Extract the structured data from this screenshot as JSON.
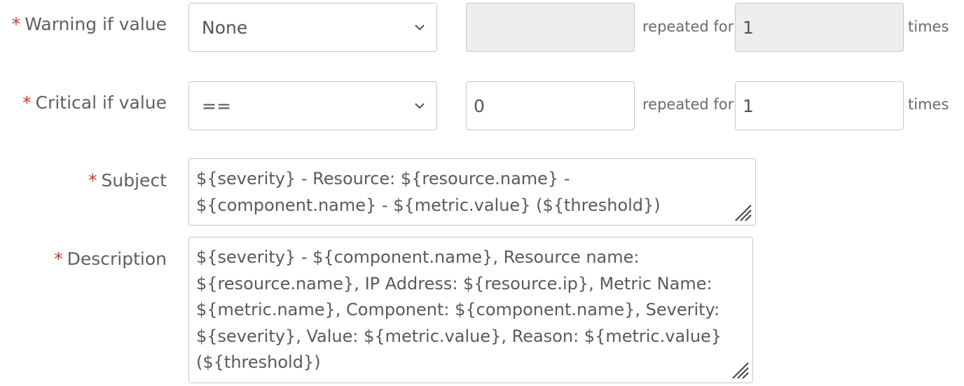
{
  "warning": {
    "label": "Warning if value",
    "required_mark": "*",
    "operator": "None",
    "value": "",
    "repeated_label": "repeated for",
    "repeat_count": "1",
    "times_label": "times"
  },
  "critical": {
    "label": "Critical if value",
    "required_mark": "*",
    "operator": "==",
    "value": "0",
    "repeated_label": "repeated for",
    "repeat_count": "1",
    "times_label": "times"
  },
  "subject": {
    "label": "Subject",
    "required_mark": "*",
    "value": "${severity} - Resource: ${resource.name} - ${component.name} - ${metric.value} (${threshold})"
  },
  "description": {
    "label": "Description",
    "required_mark": "*",
    "value": "${severity} - ${component.name}, Resource name: ${resource.name}, IP Address: ${resource.ip}, Metric Name: ${metric.name}, Component: ${component.name}, Severity: ${severity}, Value: ${metric.value}, Reason: ${metric.value} (${threshold})"
  },
  "icons": {
    "dropdown": "chevron-down-icon",
    "resize": "resize-grip-icon"
  },
  "colors": {
    "required": "#d0342c",
    "border": "#c8c8c8",
    "disabled_bg": "#eeeeee"
  }
}
